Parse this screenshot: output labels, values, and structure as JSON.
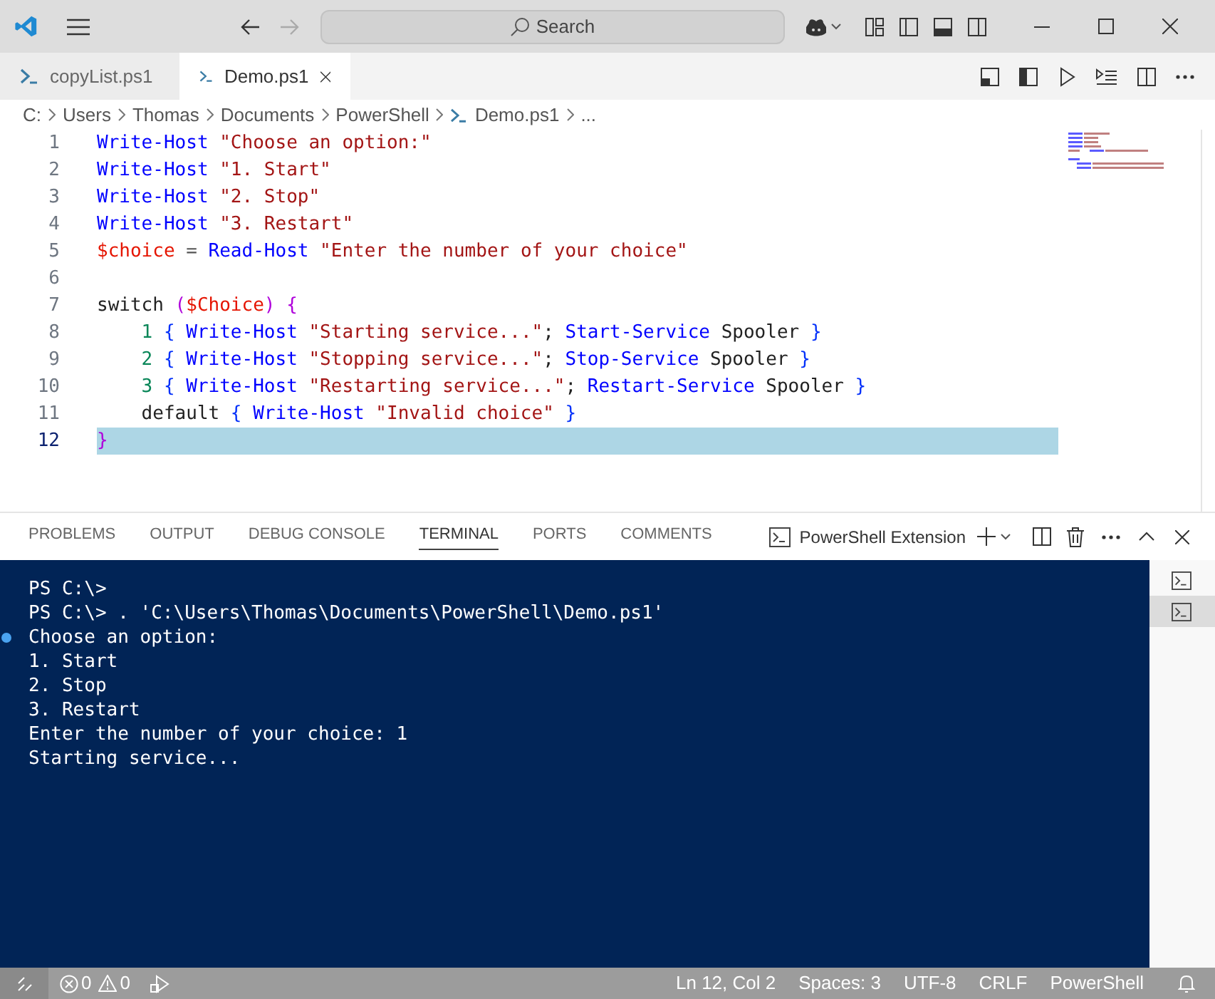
{
  "title_bar": {
    "search": {
      "placeholder": "Search"
    }
  },
  "tabs": [
    {
      "label": "copyList.ps1",
      "selected": false
    },
    {
      "label": "Demo.ps1",
      "selected": true
    }
  ],
  "breadcrumb": [
    "C:",
    "Users",
    "Thomas",
    "Documents",
    "PowerShell",
    "Demo.ps1",
    "..."
  ],
  "editor": {
    "lines": [
      {
        "number": "1",
        "selected": false,
        "tokens": [
          {
            "kind": "cmd",
            "text": "Write-Host"
          },
          {
            "kind": "str",
            "text": " \"Choose an option:\""
          }
        ]
      },
      {
        "number": "2",
        "selected": false,
        "tokens": [
          {
            "kind": "cmd",
            "text": "Write-Host"
          },
          {
            "kind": "str",
            "text": " \"1. Start\""
          }
        ]
      },
      {
        "number": "3",
        "selected": false,
        "tokens": [
          {
            "kind": "cmd",
            "text": "Write-Host"
          },
          {
            "kind": "str",
            "text": " \"2. Stop\""
          }
        ]
      },
      {
        "number": "4",
        "selected": false,
        "tokens": [
          {
            "kind": "cmd",
            "text": "Write-Host"
          },
          {
            "kind": "str",
            "text": " \"3. Restart\""
          }
        ]
      },
      {
        "number": "5",
        "selected": false,
        "tokens": [
          {
            "kind": "var",
            "text": "$choice"
          },
          {
            "kind": "op",
            "text": " = "
          },
          {
            "kind": "cmd",
            "text": "Read-Host"
          },
          {
            "kind": "str",
            "text": " \"Enter the number of your choice\""
          }
        ]
      },
      {
        "number": "6",
        "selected": false
      },
      {
        "number": "7",
        "selected": false,
        "tokens": [
          {
            "kind": "plain",
            "text": "switch "
          },
          {
            "kind": "punct",
            "text": "("
          },
          {
            "kind": "var",
            "text": "$Choice"
          },
          {
            "kind": "punct",
            "text": ") {"
          }
        ]
      },
      {
        "number": "8",
        "selected": false,
        "tokens": [
          {
            "kind": "num",
            "text": "    1"
          },
          {
            "kind": "brace",
            "text": " { "
          },
          {
            "kind": "cmd",
            "text": "Write-Host"
          },
          {
            "kind": "str",
            "text": " \"Starting service...\""
          },
          {
            "kind": "plain",
            "text": "; "
          },
          {
            "kind": "cmd",
            "text": "Start-Service"
          },
          {
            "kind": "plain",
            "text": " Spooler "
          },
          {
            "kind": "brace",
            "text": "}"
          }
        ]
      },
      {
        "number": "9",
        "selected": false,
        "tokens": [
          {
            "kind": "num",
            "text": "    2"
          },
          {
            "kind": "brace",
            "text": " { "
          },
          {
            "kind": "cmd",
            "text": "Write-Host"
          },
          {
            "kind": "str",
            "text": " \"Stopping service...\""
          },
          {
            "kind": "plain",
            "text": "; "
          },
          {
            "kind": "cmd",
            "text": "Stop-Service"
          },
          {
            "kind": "plain",
            "text": " Spooler "
          },
          {
            "kind": "brace",
            "text": "}"
          }
        ]
      },
      {
        "number": "10",
        "selected": false,
        "tokens": [
          {
            "kind": "num",
            "text": "    3"
          },
          {
            "kind": "brace",
            "text": " { "
          },
          {
            "kind": "cmd",
            "text": "Write-Host"
          },
          {
            "kind": "str",
            "text": " \"Restarting service...\""
          },
          {
            "kind": "plain",
            "text": "; "
          },
          {
            "kind": "cmd",
            "text": "Restart-Service"
          },
          {
            "kind": "plain",
            "text": " Spooler "
          },
          {
            "kind": "brace",
            "text": "}"
          }
        ]
      },
      {
        "number": "11",
        "selected": false,
        "tokens": [
          {
            "kind": "plain",
            "text": "    default"
          },
          {
            "kind": "brace",
            "text": " { "
          },
          {
            "kind": "cmd",
            "text": "Write-Host"
          },
          {
            "kind": "str",
            "text": " \"Invalid choice\""
          },
          {
            "kind": "brace",
            "text": " }"
          }
        ]
      },
      {
        "number": "12",
        "selected": true,
        "tokens": [
          {
            "kind": "punct",
            "text": "}"
          }
        ]
      }
    ]
  },
  "panel": {
    "tabs": [
      {
        "label": "PROBLEMS",
        "selected": false
      },
      {
        "label": "OUTPUT",
        "selected": false
      },
      {
        "label": "DEBUG CONSOLE",
        "selected": false
      },
      {
        "label": "TERMINAL",
        "selected": true
      },
      {
        "label": "PORTS",
        "selected": false
      },
      {
        "label": "COMMENTS",
        "selected": false
      }
    ],
    "terminal_name": "PowerShell Extension",
    "terminal_lines": [
      {
        "text": "PS C:\\>",
        "marked": false
      },
      {
        "text": "PS C:\\> . 'C:\\Users\\Thomas\\Documents\\PowerShell\\Demo.ps1'",
        "marked": false
      },
      {
        "text": "Choose an option:",
        "marked": true
      },
      {
        "text": "1. Start",
        "marked": false
      },
      {
        "text": "2. Stop",
        "marked": false
      },
      {
        "text": "3. Restart",
        "marked": false
      },
      {
        "text": "Enter the number of your choice: 1",
        "marked": false
      },
      {
        "text": "Starting service...",
        "marked": false
      }
    ],
    "terminals": [
      {
        "selected": false
      },
      {
        "selected": true
      }
    ]
  },
  "status_bar": {
    "errors": "0",
    "warnings": "0",
    "items": [
      "Ln 12, Col 2",
      "Spaces: 3",
      "UTF-8",
      "CRLF",
      "PowerShell"
    ]
  }
}
